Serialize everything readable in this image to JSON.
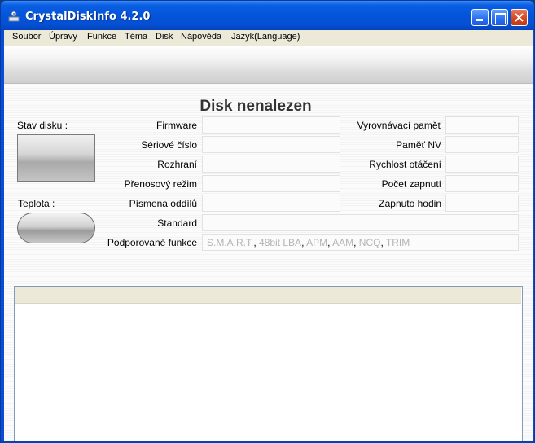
{
  "window": {
    "title": "CrystalDiskInfo 4.2.0",
    "icon": "crystaldiskinfo-app-icon",
    "controls": [
      "minimize-icon",
      "maximize-icon",
      "close-icon"
    ]
  },
  "menu": {
    "items": [
      "Soubor",
      "Úpravy",
      "Funkce",
      "Téma",
      "Disk",
      "Nápověda",
      "Jazyk(Language)"
    ]
  },
  "main": {
    "disk_title": "Disk nenalezen",
    "status_label": "Stav disku :",
    "temperature_label": "Teplota :",
    "left_fields": {
      "firmware": "Firmware",
      "serial": "Sériové číslo",
      "interface": "Rozhraní",
      "transfer_mode": "Přenosový režim",
      "drive_letters": "Písmena oddílů",
      "standard": "Standard",
      "features": "Podporované funkce"
    },
    "right_fields": {
      "cache": "Vyrovnávací paměť",
      "nv_cache": "Paměť NV",
      "rotation": "Rychlost otáčení",
      "power_on_count": "Počet zapnutí",
      "power_on_hours": "Zapnuto hodin"
    },
    "supported_features": [
      "S.M.A.R.T.",
      "48bit LBA",
      "APM",
      "AAM",
      "NCQ",
      "TRIM"
    ],
    "feature_separator": ", "
  },
  "colors": {
    "titlebar": "#0454d9",
    "menubar": "#ece9d8",
    "disabled_feature": "#b4b4b4"
  }
}
